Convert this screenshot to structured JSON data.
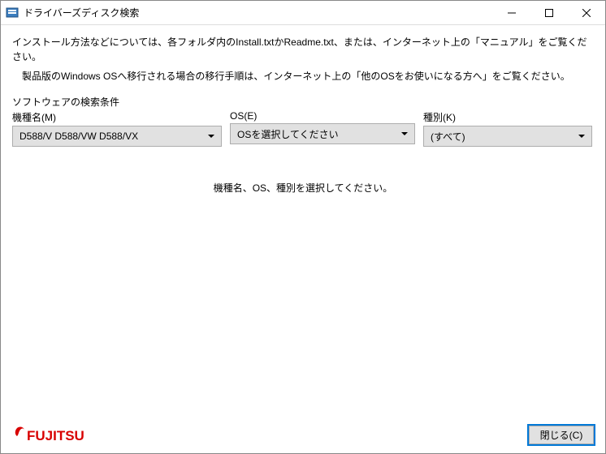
{
  "titlebar": {
    "title": "ドライバーズディスク検索"
  },
  "info": {
    "line1": "インストール方法などについては、各フォルダ内のInstall.txtかReadme.txt、または、インターネット上の「マニュアル」をご覧ください。",
    "line2": "製品版のWindows OSへ移行される場合の移行手順は、インターネット上の「他のOSをお使いになる方へ」をご覧ください。"
  },
  "search": {
    "section_title": "ソフトウェアの検索条件",
    "model_label": "機種名(M)",
    "model_value": "D588/V D588/VW D588/VX",
    "os_label": "OS(E)",
    "os_value": "OSを選択してください",
    "kind_label": "種別(K)",
    "kind_value": "(すべて)"
  },
  "message": "機種名、OS、種別を選択してください。",
  "footer": {
    "logo_text": "FUJITSU",
    "close_label": "閉じる(C)"
  }
}
